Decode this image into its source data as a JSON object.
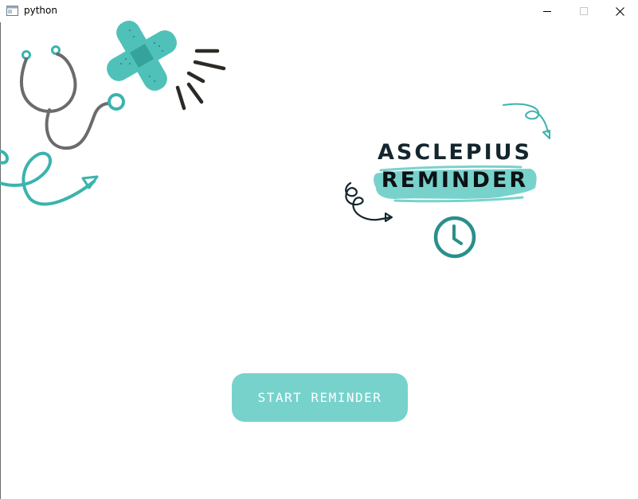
{
  "window": {
    "title": "python",
    "controls": {
      "minimize_icon": "minimize-icon",
      "maximize_icon": "maximize-icon",
      "close_icon": "close-icon"
    }
  },
  "brand": {
    "title": "ASCLEPIUS",
    "subtitle": "REMINDER"
  },
  "main": {
    "start_button_label": "START REMINDER"
  },
  "colors": {
    "accent": "#78d2cc",
    "teal_dark": "#2a8f8a",
    "text_dark": "#14262d",
    "window_bg": "#ffffff"
  },
  "icons": [
    "stethoscope-icon",
    "bandage-icon",
    "clock-icon",
    "curly-arrow-icon"
  ]
}
